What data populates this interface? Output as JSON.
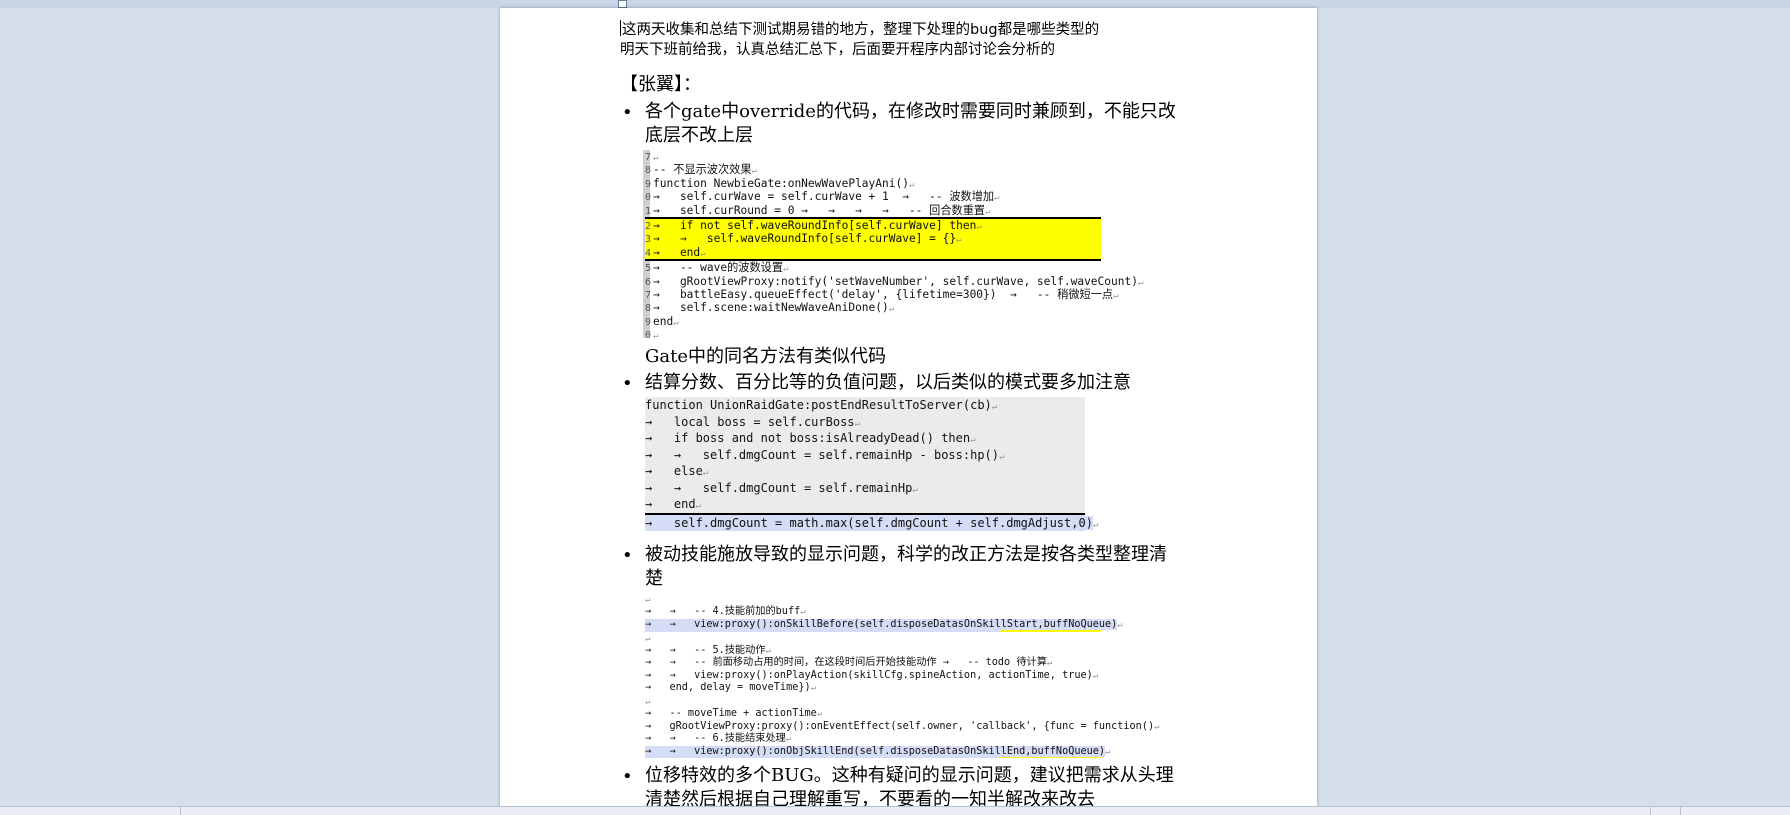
{
  "intro": {
    "line1": "这两天收集和总结下测试期易错的地方，整理下处理的bug都是哪些类型的",
    "line2": "明天下班前给我，认真总结汇总下，后面要开程序内部讨论会分析的"
  },
  "heading": "【张翼】：",
  "bullets": [
    {
      "text": "各个gate中override的代码，在修改时需要同时兼顾到，不能只改底层不改上层",
      "note": "Gate中的同名方法有类似代码"
    },
    {
      "text": "结算分数、百分比等的负值问题，以后类似的模式要多加注意"
    },
    {
      "text": "被动技能施放导致的显示问题，科学的改正方法是按各类型整理清楚"
    },
    {
      "text": "位移特效的多个BUG。这种有疑问的显示问题，建议把需求从头理清楚然后根据自己理解重写，不要看的一知半解改来改去"
    }
  ],
  "code1": {
    "lines": [
      {
        "n": "7",
        "t": "",
        "tag": ""
      },
      {
        "n": "8",
        "t": "-- 不显示波次效果",
        "tag": ""
      },
      {
        "n": "9",
        "t": "function NewbieGate:onNewWavePlayAni()",
        "tag": ""
      },
      {
        "n": "0",
        "t": "→   self.curWave = self.curWave + 1  →   -- 波数增加",
        "tag": ""
      },
      {
        "n": "1",
        "t": "→   self.curRound = 0 →   →   →   →   -- 回合数重置",
        "tag": ""
      },
      {
        "n": "2",
        "t": "→   if not self.waveRoundInfo[self.curWave] then",
        "tag": "hl"
      },
      {
        "n": "3",
        "t": "→   →   self.waveRoundInfo[self.curWave] = {}",
        "tag": "hl"
      },
      {
        "n": "4",
        "t": "→   end",
        "tag": "hl"
      },
      {
        "n": "5",
        "t": "→   -- wave的波数设置",
        "tag": ""
      },
      {
        "n": "6",
        "t": "→   gRootViewProxy:notify('setWaveNumber', self.curWave, self.waveCount)",
        "tag": ""
      },
      {
        "n": "7",
        "t": "→   battleEasy.queueEffect('delay', {lifetime=300})  →   -- 稍微短一点",
        "tag": ""
      },
      {
        "n": "8",
        "t": "→   self.scene:waitNewWaveAniDone()",
        "tag": ""
      },
      {
        "n": "9",
        "t": "end",
        "tag": ""
      },
      {
        "n": "0",
        "t": "",
        "tag": ""
      }
    ]
  },
  "code2": {
    "lines": [
      {
        "t": "function UnionRaidGate:postEndResultToServer(cb)",
        "tag": ""
      },
      {
        "t": "→   local boss = self.curBoss",
        "tag": ""
      },
      {
        "t": "→   if boss and not boss:isAlreadyDead() then",
        "tag": ""
      },
      {
        "t": "→   →   self.dmgCount = self.remainHp - boss:hp()",
        "tag": ""
      },
      {
        "t": "→   else",
        "tag": ""
      },
      {
        "t": "→   →   self.dmgCount = self.remainHp",
        "tag": ""
      },
      {
        "t": "→   end",
        "tag": ""
      },
      {
        "t": "→   self.dmgCount = math.max(self.dmgCount + self.dmgAdjust,0)",
        "tag": "sel"
      }
    ]
  },
  "code3": {
    "groups": [
      [
        "→   →   -- 4.技能前加的buff",
        "→   →   view:proxy():onSkillBefore(self.disposeDatasOnSkillStart,buffNoQueue)"
      ],
      [
        "→   →   -- 5.技能动作",
        "→   →   -- 前面移动占用的时间，在这段时间后开始技能动作 →   -- todo 待计算",
        "→   →   view:proxy():onPlayAction(skillCfg.spineAction, actionTime, true)",
        "→   end, delay = moveTime})"
      ],
      [
        "→   -- moveTime + actionTime",
        "→   gRootViewProxy:proxy():onEventEffect(self.owner, 'callback', {func = function()",
        "→   →   -- 6.技能结束处理",
        "→   →   view:proxy():onObjSkillEnd(self.disposeDatasOnSkillEnd,buffNoQueue)"
      ]
    ]
  }
}
